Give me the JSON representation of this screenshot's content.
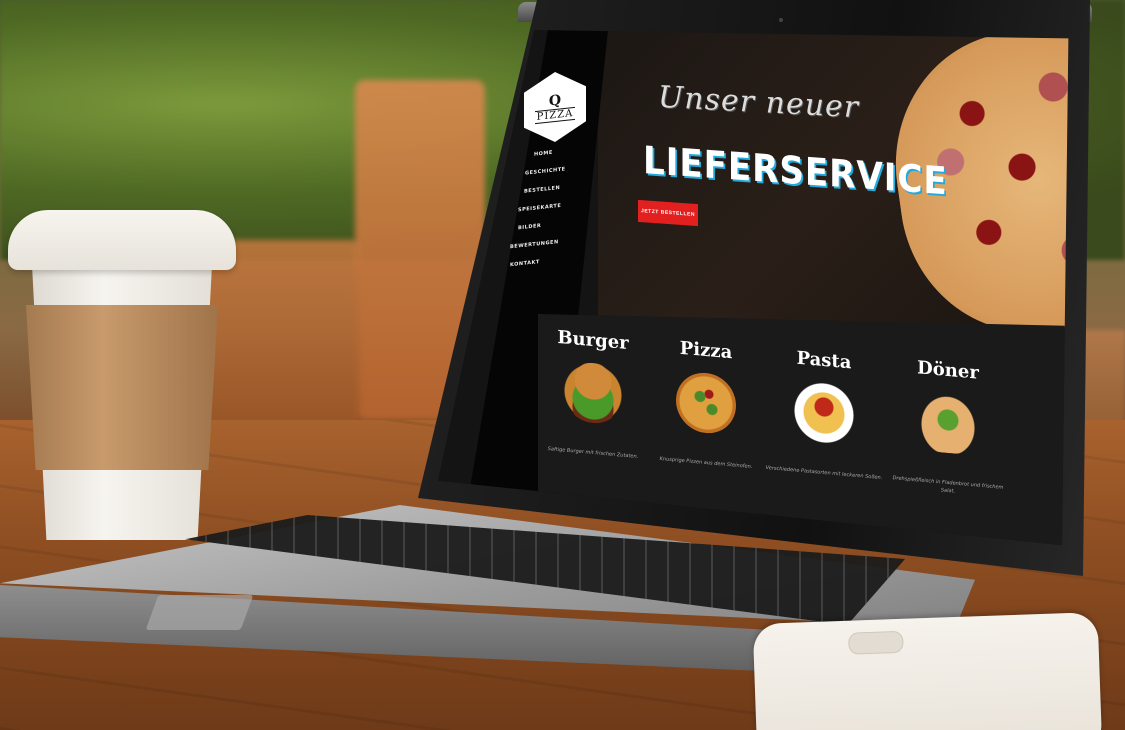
{
  "site": {
    "logo": {
      "letter": "Q",
      "name": "PIZZA"
    },
    "nav": [
      {
        "label": "HOME"
      },
      {
        "label": "GESCHICHTE"
      },
      {
        "label": "BESTELLEN"
      },
      {
        "label": "SPEISEKARTE"
      },
      {
        "label": "BILDER"
      },
      {
        "label": "BEWERTUNGEN"
      },
      {
        "label": "KONTAKT"
      }
    ],
    "hero": {
      "line1": "Unser neuer",
      "line2": "LIEFERSERVICE",
      "button": "JETZT BESTELLEN"
    },
    "categories": [
      {
        "title": "Burger",
        "desc": "Saftige Burger mit frischen Zutaten.",
        "icon": "burger-image"
      },
      {
        "title": "Pizza",
        "desc": "Knusprige Pizzen aus dem Steinofen.",
        "icon": "pizza-image"
      },
      {
        "title": "Pasta",
        "desc": "Verschiedene Pastasorten mit leckeren Soßen.",
        "icon": "pasta-image"
      },
      {
        "title": "Döner",
        "desc": "Drehspießfleisch in Fladenbrot und frischem Salat.",
        "icon": "doner-image"
      }
    ]
  },
  "colors": {
    "accent": "#e32020",
    "background": "#141414",
    "sidebar": "#050505"
  }
}
